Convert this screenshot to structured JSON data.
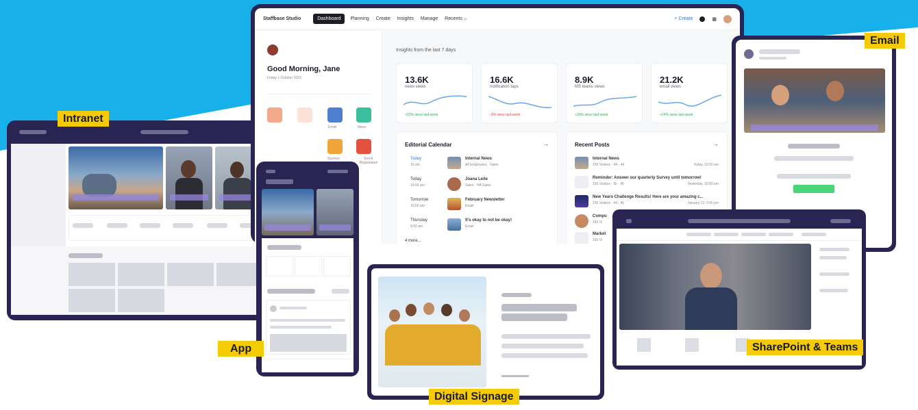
{
  "labels": {
    "intranet": "Intranet",
    "app": "App",
    "email": "Email",
    "signage": "Digital Signage",
    "sharepoint": "SharePoint & Teams"
  },
  "dashboard": {
    "brand": "Staffbase Studio",
    "nav": [
      "Dashboard",
      "Planning",
      "Create",
      "Insights",
      "Manage",
      "Recents ⌵"
    ],
    "create_label": "+ Create",
    "greeting": "Good Morning, Jane",
    "date": "Friday 1 October 2023",
    "insights_title": "Insights from the last 7 days",
    "stats": [
      {
        "value": "13.6K",
        "label": "news views",
        "foot": "+12% since last week",
        "trend": "up"
      },
      {
        "value": "16.6K",
        "label": "notification taps",
        "foot": "-3% since last week",
        "trend": "down"
      },
      {
        "value": "8.9K",
        "label": "MS teams views",
        "foot": "+30% since last week",
        "trend": "up"
      },
      {
        "value": "21.2K",
        "label": "email views",
        "foot": "+24% since last week",
        "trend": "up"
      }
    ],
    "quick_actions": [
      "Email",
      "News",
      "Surveys",
      "Event Registration"
    ],
    "editorial_title": "Editorial Calendar",
    "calendar": [
      {
        "day": "Today",
        "time": "10 am",
        "title": "Internal News",
        "meta": "All Employees · Sales"
      },
      {
        "day": "Today",
        "time": "10:00 am",
        "title": "Joana Leite",
        "meta": "Sales · HA Sales"
      },
      {
        "day": "Tomorrow",
        "time": "10:00 am",
        "title": "February Newsletter",
        "meta": "Email"
      },
      {
        "day": "Thursday",
        "time": "8:00 am",
        "title": "It's okay to not be okay!",
        "meta": "Email"
      }
    ],
    "more_label": "4 more...",
    "recent_title": "Recent Posts",
    "posts": [
      {
        "title": "Internal News",
        "meta": "150 Visitors · 44 · 44",
        "time": "Today, 10:00 am"
      },
      {
        "title": "Reminder: Answer our quarterly Survey until tomorrow!",
        "meta": "150 Visitors · 5k · 45",
        "time": "Yesterday, 10:00 am"
      },
      {
        "title": "New Years Challenge Results! Here are your amazing c...",
        "meta": "150 Visitors · 44 · 45",
        "time": "January 12, 3:00 pm"
      },
      {
        "title": "Compu",
        "meta": "150 Vi",
        "time": ""
      },
      {
        "title": "Market",
        "meta": "150 Vi",
        "time": ""
      }
    ]
  },
  "colors": {
    "frame": "#2a2452",
    "sky": "#18b0ea",
    "tag": "#f5cb08",
    "accent": "#3a72d6",
    "positive": "#2fa84f",
    "negative": "#d64545"
  }
}
